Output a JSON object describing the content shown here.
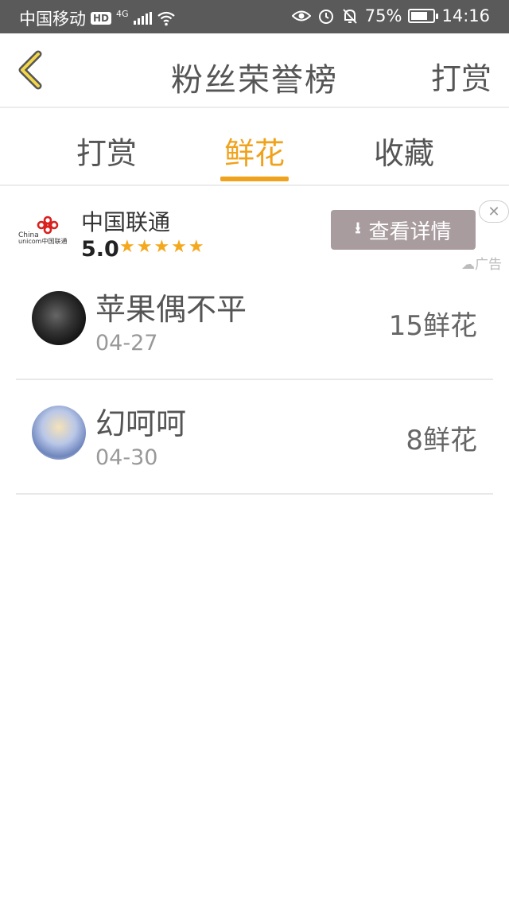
{
  "status_bar": {
    "carrier": "中国移动",
    "hd": "HD",
    "network": "4G",
    "battery": "75%",
    "battery_level": 0.75,
    "time": "14:16"
  },
  "header": {
    "title": "粉丝荣誉榜",
    "action": "打赏"
  },
  "tabs": [
    {
      "label": "打赏",
      "active": false
    },
    {
      "label": "鲜花",
      "active": true
    },
    {
      "label": "收藏",
      "active": false
    }
  ],
  "ad": {
    "logo_text_top": "China",
    "logo_text_bottom": "unicom中国联通",
    "name": "中国联通",
    "rating": "5.0",
    "stars": "★★★★★",
    "button_label": "查看详情",
    "close": "✕",
    "label": "广告"
  },
  "list": [
    {
      "name": "苹果偶不平",
      "date": "04-27",
      "count": "15鲜花"
    },
    {
      "name": "幻呵呵",
      "date": "04-30",
      "count": "8鲜花"
    }
  ]
}
